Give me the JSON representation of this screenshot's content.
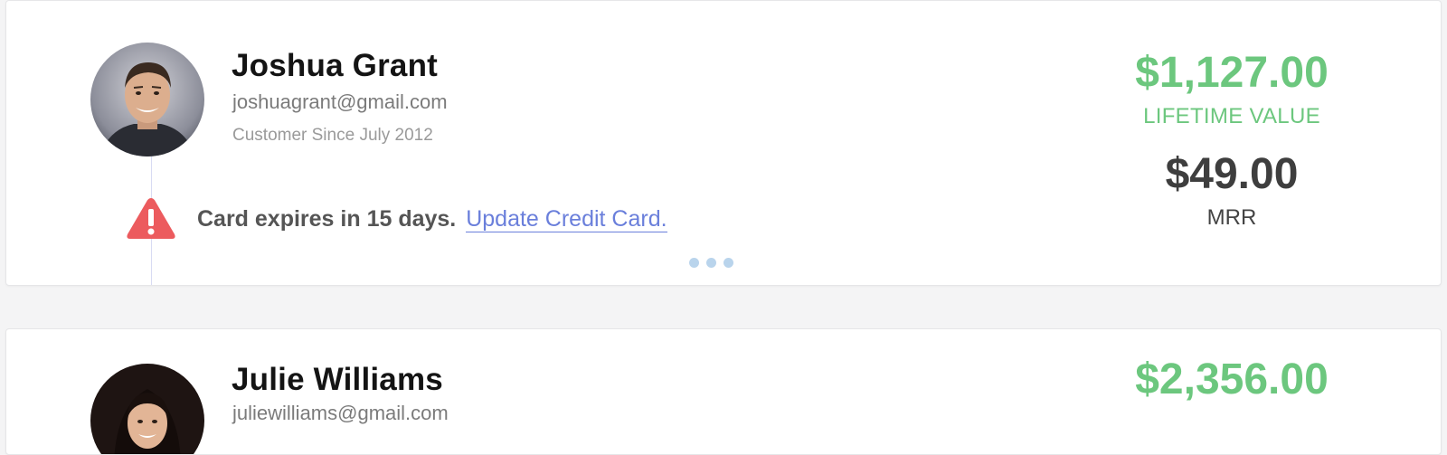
{
  "customers": [
    {
      "name": "Joshua Grant",
      "email": "joshuagrant@gmail.com",
      "customer_since": "Customer Since July 2012",
      "alert": {
        "text": "Card expires in 15 days.",
        "link_label": "Update Credit Card."
      },
      "lifetime_value": "$1,127.00",
      "lifetime_value_label": "LIFETIME VALUE",
      "mrr": "$49.00",
      "mrr_label": "MRR"
    },
    {
      "name": "Julie Williams",
      "email": "juliewilliams@gmail.com",
      "lifetime_value": "$2,356.00"
    }
  ],
  "colors": {
    "ltv_green": "#6cc77e",
    "link_blue": "#6a7fdb",
    "alert_red": "#ec5b5e",
    "dots_blue": "#b9d4ec"
  },
  "icons": {
    "alert": "warning-triangle-icon",
    "more": "more-dots-icon"
  }
}
